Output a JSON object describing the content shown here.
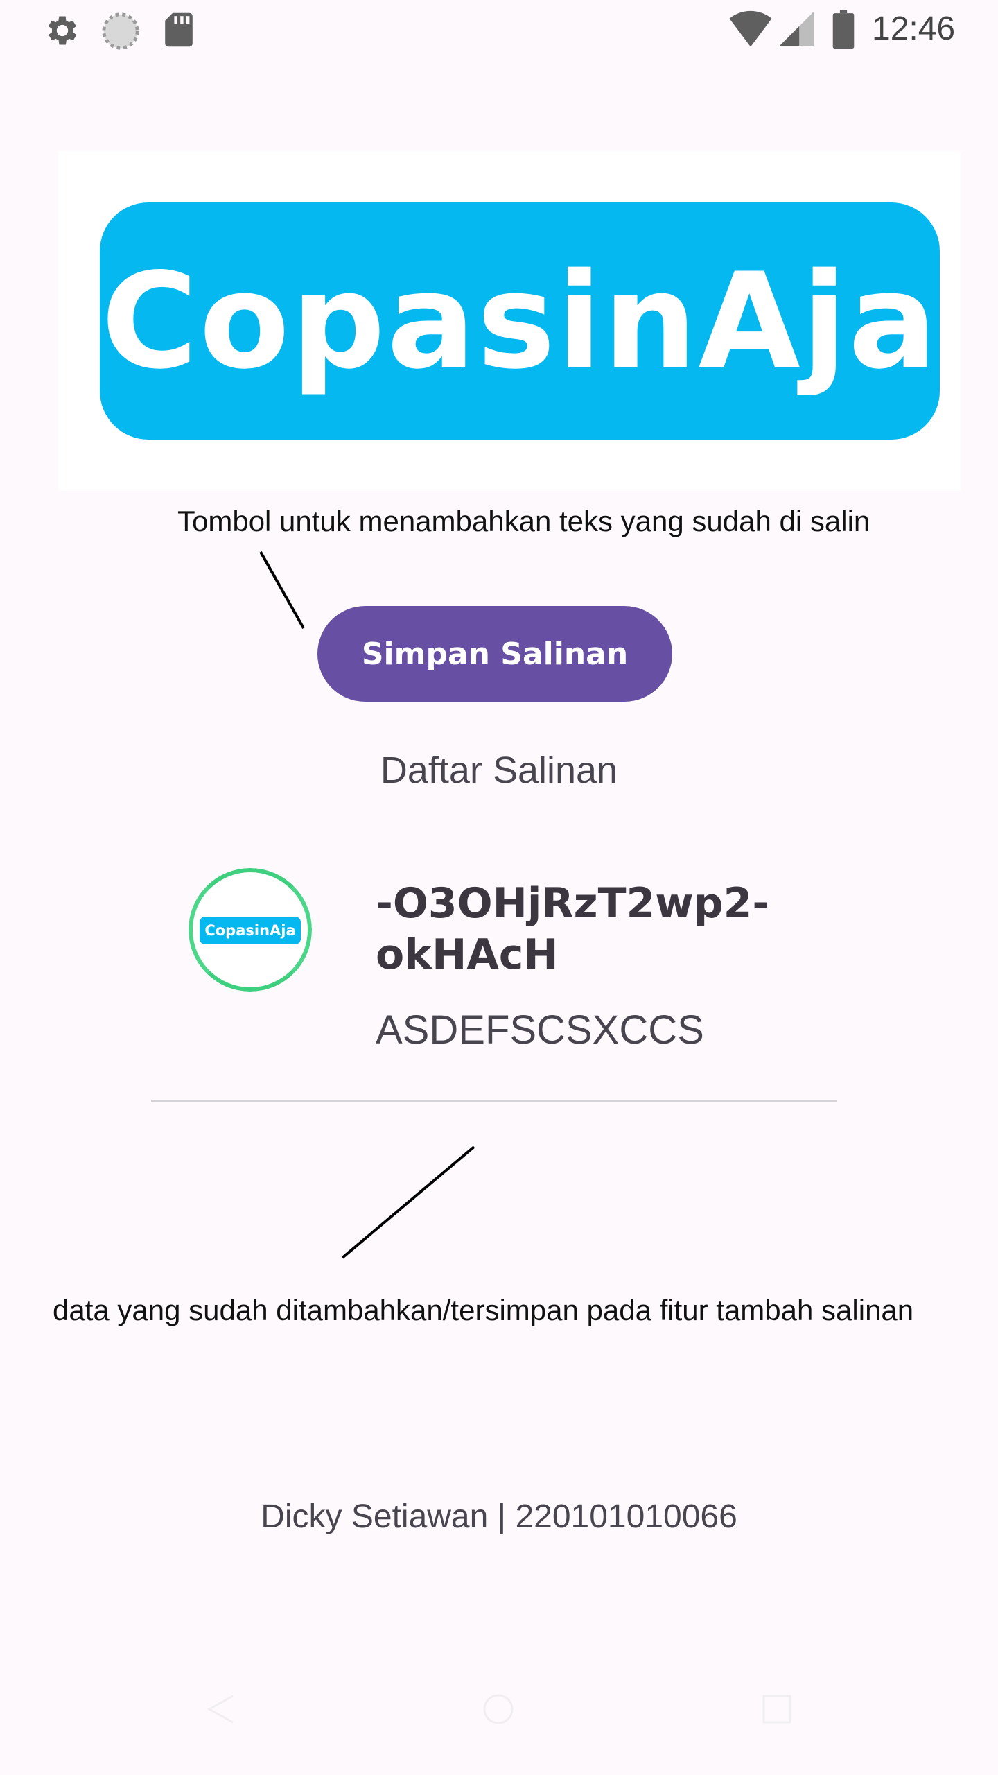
{
  "status_bar": {
    "time": "12:46",
    "icons": [
      "gear-icon",
      "sync-icon",
      "sd-card-icon",
      "wifi-icon",
      "signal-icon",
      "battery-icon"
    ]
  },
  "banner": {
    "logo_text": "CopasinAja",
    "color": "#05b8f0"
  },
  "annotations": {
    "top": "Tombol untuk menambahkan teks yang sudah di salin",
    "bottom": "data yang sudah ditambahkan/tersimpan pada fitur tambah salinan"
  },
  "actions": {
    "save_label": "Simpan Salinan",
    "button_color": "#6750a4"
  },
  "list": {
    "title": "Daftar Salinan",
    "items": [
      {
        "avatar_text": "CopasinAja",
        "title": "-O3OHjRzT2wp2-okHAcH",
        "subtitle": "ASDEFSCSXCCS"
      }
    ]
  },
  "footer": {
    "text": "Dicky Setiawan | 220101010066"
  },
  "nav_bar": {
    "icons": [
      "back-icon",
      "home-icon",
      "recents-icon"
    ]
  }
}
